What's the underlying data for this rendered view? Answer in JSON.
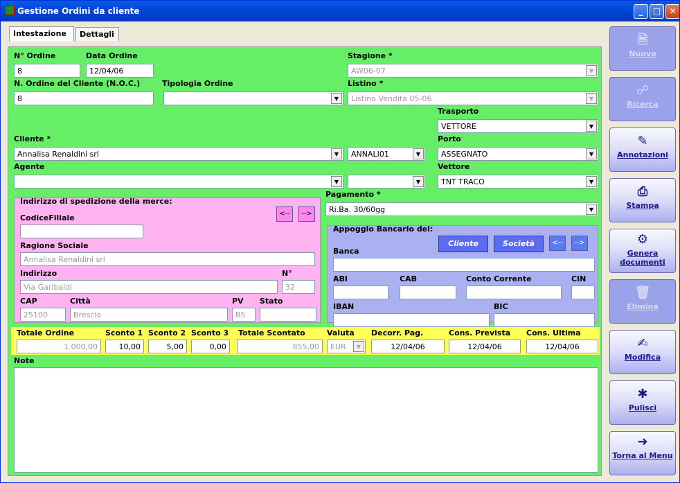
{
  "window": {
    "title": "Gestione Ordini da cliente",
    "min": "_",
    "max": "□",
    "close": "✕"
  },
  "tabs": [
    "Intestazione",
    "Dettagli"
  ],
  "form": {
    "n_ordine": {
      "label": "N° Ordine",
      "value": "8"
    },
    "data_ordine": {
      "label": "Data Ordine",
      "value": "12/04/06"
    },
    "stagione": {
      "label": "Stagione *",
      "value": "AW06-07"
    },
    "noc": {
      "label": "N. Ordine del Cliente (N.O.C.)",
      "value": "8"
    },
    "tipologia": {
      "label": "Tipologia Ordine",
      "value": ""
    },
    "listino": {
      "label": "Listino *",
      "value": "Listino Vendita 05-06"
    },
    "trasporto": {
      "label": "Trasporto",
      "value": "VETTORE"
    },
    "cliente": {
      "label": "Cliente *",
      "value": "Annalisa Renaldini srl",
      "code": "ANNALI01"
    },
    "porto": {
      "label": "Porto",
      "value": "ASSEGNATO"
    },
    "agente": {
      "label": "Agente",
      "value": "",
      "code": ""
    },
    "vettore": {
      "label": "Vettore",
      "value": "TNT TRACO"
    },
    "pagamento": {
      "label": "Pagamento *",
      "value": "Ri.Ba. 30/60gg"
    }
  },
  "ship": {
    "title": "Indirizzo di spedizione della merce:",
    "prev": "<--",
    "next": "-->",
    "codice_filiale": {
      "label": "CodiceFiliale",
      "value": ""
    },
    "ragione_sociale": {
      "label": "Ragione Sociale",
      "value": "Annalisa Renaldini srl"
    },
    "indirizzo": {
      "label": "Indirizzo",
      "value": "Via Garibaldi"
    },
    "numero": {
      "label": "N°",
      "value": "32"
    },
    "cap": {
      "label": "CAP",
      "value": "25100"
    },
    "citta": {
      "label": "Città",
      "value": "Brescia"
    },
    "pv": {
      "label": "PV",
      "value": "BS"
    },
    "stato": {
      "label": "Stato",
      "value": ""
    }
  },
  "bank": {
    "title": "Appoggio Bancario del:",
    "cliente_btn": "Cliente",
    "societa_btn": "Società",
    "prev": "<--",
    "next": "-->",
    "banca": {
      "label": "Banca",
      "value": ""
    },
    "abi": {
      "label": "ABI",
      "value": ""
    },
    "cab": {
      "label": "CAB",
      "value": ""
    },
    "conto": {
      "label": "Conto Corrente",
      "value": ""
    },
    "cin": {
      "label": "CIN",
      "value": ""
    },
    "iban": {
      "label": "IBAN",
      "value": ""
    },
    "bic": {
      "label": "BIC",
      "value": ""
    }
  },
  "totals": {
    "totale_ordine": {
      "label": "Totale Ordine",
      "value": "1.000,00"
    },
    "sconto1": {
      "label": "Sconto 1",
      "value": "10,00"
    },
    "sconto2": {
      "label": "Sconto 2",
      "value": "5,00"
    },
    "sconto3": {
      "label": "Sconto 3",
      "value": "0,00"
    },
    "totale_scontato": {
      "label": "Totale Scontato",
      "value": "855,00"
    },
    "valuta": {
      "label": "Valuta",
      "value": "EUR"
    },
    "decorr": {
      "label": "Decorr. Pag.",
      "value": "12/04/06"
    },
    "cons_prevista": {
      "label": "Cons. Prevista",
      "value": "12/04/06"
    },
    "cons_ultima": {
      "label": "Cons. Ultima",
      "value": "12/04/06"
    }
  },
  "note": {
    "label": "Note",
    "value": ""
  },
  "sidebar": [
    {
      "label": "Nuovo",
      "icon": "document-icon"
    },
    {
      "label": "Ricerca",
      "icon": "binoculars-icon"
    },
    {
      "label": "Annotazioni",
      "icon": "notepad-icon"
    },
    {
      "label": "Stampa",
      "icon": "printer-icon"
    },
    {
      "label": "Genera documenti",
      "icon": "generate-icon"
    },
    {
      "label": "Elimina",
      "icon": "trash-icon"
    },
    {
      "label": "Modifica",
      "icon": "edit-icon"
    },
    {
      "label": "Pulisci",
      "icon": "broom-icon"
    },
    {
      "label": "Torna al Menu",
      "icon": "exit-door-icon"
    }
  ]
}
